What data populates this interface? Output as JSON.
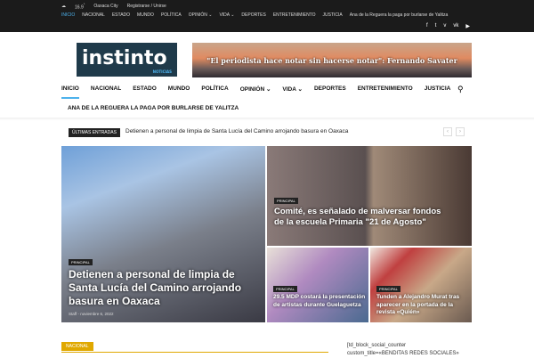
{
  "topbar": {
    "temp": "16.9",
    "unit": "°",
    "city": "Oaxaca City",
    "register": "Registrarse / Unirse",
    "menu": [
      "INICIO",
      "NACIONAL",
      "ESTADO",
      "MUNDO",
      "POLÍTICA",
      "OPINIÓN ⌄",
      "VIDA ⌄",
      "DEPORTES",
      "ENTRETENIMIENTO",
      "JUSTICIA",
      "Ana de la Reguera la paga por burlarse de Yalitza"
    ],
    "social": [
      "f",
      "t",
      "v",
      "vk",
      "▶"
    ]
  },
  "logo": {
    "text": "instinto",
    "sub": "NOTICIAS"
  },
  "banner": {
    "text": "\"El periodista hace notar sin hacerse notar\": Fernando Savater"
  },
  "nav": {
    "items": [
      "INICIO",
      "NACIONAL",
      "ESTADO",
      "MUNDO",
      "POLÍTICA",
      "OPINIÓN ⌄",
      "VIDA ⌄",
      "DEPORTES",
      "ENTRETENIMIENTO",
      "JUSTICIA"
    ],
    "second": "ANA DE LA REGUERA LA PAGA POR BURLARSE DE YALITZA"
  },
  "ticker": {
    "label": "ÚLTIMAS ENTRADAS",
    "text": "Detienen a personal de limpia de Santa Lucía del Camino arrojando basura en Oaxaca",
    "prev": "‹",
    "next": "›"
  },
  "tiles": [
    {
      "cat": "PRINCIPAL",
      "title": "Detienen a personal de limpia de Santa Lucía del Camino arrojando basura en Oaxaca",
      "author": "Staff",
      "date": "noviembre 6, 2022"
    },
    {
      "cat": "PRINCIPAL",
      "title": "Comité, es señalado de malversar fondos de la escuela Primaria \"21 de Agosto\""
    },
    {
      "cat": "PRINCIPAL",
      "title": "29.5 MDP costará la presentación de artistas durante Guelaguetza"
    },
    {
      "cat": "PRINCIPAL",
      "title": "Tunden a Alejandro Murat tras aparecer en la portada de la revista «Quién»"
    }
  ],
  "section": {
    "label": "NACIONAL"
  },
  "sidebar": {
    "line1": "[td_block_social_counter",
    "line2": "custom_title=«BENDITAS REDES SOCIALES»"
  }
}
